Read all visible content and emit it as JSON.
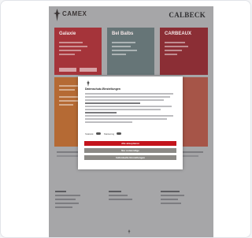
{
  "site": {
    "brand_left": "CAMEX",
    "brand_right": "CALBECK",
    "tiles": [
      {
        "title": "Galaxie",
        "color": "#b3343a"
      },
      {
        "title": "Bel Balbs",
        "color": "#6e7e80"
      },
      {
        "title": "CARBEAUX",
        "color": "#8e2f36"
      },
      {
        "title": "",
        "color": "#c07033"
      },
      {
        "title": "",
        "color": "#7a6ba4"
      },
      {
        "title": "",
        "color": "#b25a4a"
      }
    ]
  },
  "modal": {
    "title": "Datenschutz-Einstellungen",
    "toggles": [
      "Statistik",
      "Marketing"
    ],
    "accept_all_label": "Alle akzeptieren",
    "essential_only_label": "Nur notwendige",
    "settings_label": "Individuelle Einstellungen"
  },
  "colors": {
    "accent": "#c4141c",
    "overlay": "#a6a6a8"
  }
}
